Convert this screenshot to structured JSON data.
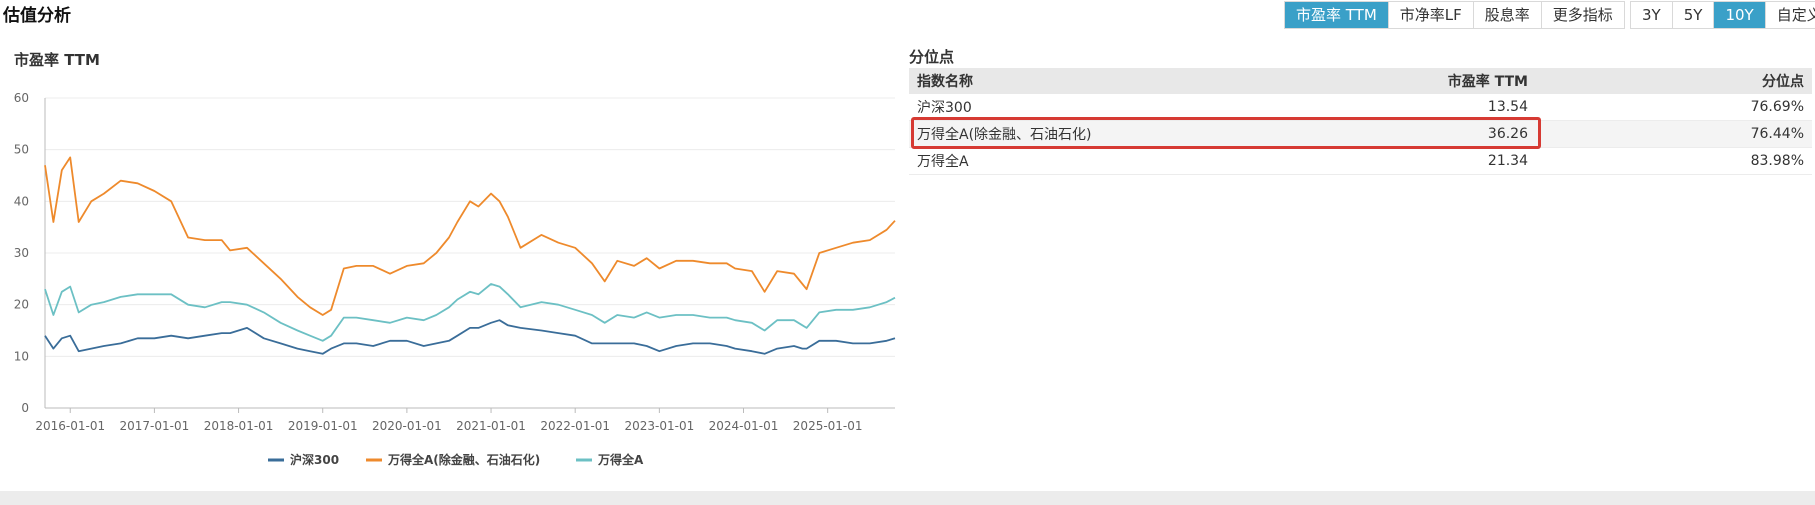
{
  "header": {
    "title": "估值分析",
    "metric_tabs": [
      {
        "label": "市盈率 TTM",
        "active": true
      },
      {
        "label": "市净率LF",
        "active": false
      },
      {
        "label": "股息率",
        "active": false
      },
      {
        "label": "更多指标",
        "active": false
      }
    ],
    "range_tabs": [
      {
        "label": "3Y",
        "active": false
      },
      {
        "label": "5Y",
        "active": false
      },
      {
        "label": "10Y",
        "active": true
      },
      {
        "label": "自定义",
        "active": false
      }
    ]
  },
  "chart": {
    "title": "市盈率 TTM"
  },
  "table": {
    "title": "分位点",
    "headers": [
      "指数名称",
      "市盈率 TTM",
      "分位点"
    ],
    "rows": [
      {
        "name": "沪深300",
        "pe": "13.54",
        "pct": "76.69%"
      },
      {
        "name": "万得全A(除金融、石油石化)",
        "pe": "36.26",
        "pct": "76.44%"
      },
      {
        "name": "万得全A",
        "pe": "21.34",
        "pct": "83.98%"
      }
    ]
  },
  "colors": {
    "accent": "#3aa0c8",
    "hs300": "#3a6d99",
    "wind_ex": "#ee8a2c",
    "wind_a": "#6cc0c4",
    "highlight": "#d63a33"
  },
  "chart_data": {
    "type": "line",
    "title": "市盈率 TTM",
    "ylim": [
      0,
      60
    ],
    "yticks": [
      0,
      10,
      20,
      30,
      40,
      50,
      60
    ],
    "xlim": [
      2015.7,
      2025.8
    ],
    "xticks": [
      "2016-01-01",
      "2017-01-01",
      "2018-01-01",
      "2019-01-01",
      "2020-01-01",
      "2021-01-01",
      "2022-01-01",
      "2023-01-01",
      "2024-01-01",
      "2025-01-01"
    ],
    "grid": "horizontal",
    "legend": "bottom",
    "x": [
      2015.7,
      2015.8,
      2015.9,
      2016.0,
      2016.1,
      2016.25,
      2016.4,
      2016.6,
      2016.8,
      2017.0,
      2017.2,
      2017.4,
      2017.6,
      2017.8,
      2017.9,
      2018.1,
      2018.3,
      2018.5,
      2018.7,
      2018.85,
      2019.0,
      2019.1,
      2019.25,
      2019.4,
      2019.6,
      2019.8,
      2020.0,
      2020.2,
      2020.35,
      2020.5,
      2020.6,
      2020.75,
      2020.85,
      2021.0,
      2021.1,
      2021.2,
      2021.35,
      2021.6,
      2021.8,
      2022.0,
      2022.2,
      2022.35,
      2022.5,
      2022.7,
      2022.85,
      2023.0,
      2023.2,
      2023.4,
      2023.6,
      2023.8,
      2023.9,
      2024.1,
      2024.25,
      2024.4,
      2024.6,
      2024.7,
      2024.75,
      2024.9,
      2025.1,
      2025.3,
      2025.5,
      2025.7,
      2025.8
    ],
    "series": [
      {
        "name": "沪深300",
        "values": [
          14.0,
          11.5,
          13.5,
          14.0,
          11.0,
          11.5,
          12.0,
          12.5,
          13.5,
          13.5,
          14.0,
          13.5,
          14.0,
          14.5,
          14.5,
          15.5,
          13.5,
          12.5,
          11.5,
          11.0,
          10.5,
          11.5,
          12.5,
          12.5,
          12.0,
          13.0,
          13.0,
          12.0,
          12.5,
          13.0,
          14.0,
          15.5,
          15.5,
          16.5,
          17.0,
          16.0,
          15.5,
          15.0,
          14.5,
          14.0,
          12.5,
          12.5,
          12.5,
          12.5,
          12.0,
          11.0,
          12.0,
          12.5,
          12.5,
          12.0,
          11.5,
          11.0,
          10.5,
          11.5,
          12.0,
          11.5,
          11.5,
          13.0,
          13.0,
          12.5,
          12.5,
          13.0,
          13.5
        ]
      },
      {
        "name": "万得全A(除金融、石油石化)",
        "values": [
          47.0,
          36.0,
          46.0,
          48.5,
          36.0,
          40.0,
          41.5,
          44.0,
          43.5,
          42.0,
          40.0,
          33.0,
          32.5,
          32.5,
          30.5,
          31.0,
          28.0,
          25.0,
          21.5,
          19.5,
          18.0,
          19.0,
          27.0,
          27.5,
          27.5,
          26.0,
          27.5,
          28.0,
          30.0,
          33.0,
          36.0,
          40.0,
          39.0,
          41.5,
          40.0,
          37.0,
          31.0,
          33.5,
          32.0,
          31.0,
          28.0,
          24.5,
          28.5,
          27.5,
          29.0,
          27.0,
          28.5,
          28.5,
          28.0,
          28.0,
          27.0,
          26.5,
          22.5,
          26.5,
          26.0,
          24.0,
          23.0,
          30.0,
          31.0,
          32.0,
          32.5,
          34.5,
          36.26
        ]
      },
      {
        "name": "万得全A",
        "values": [
          23.0,
          18.0,
          22.5,
          23.5,
          18.5,
          20.0,
          20.5,
          21.5,
          22.0,
          22.0,
          22.0,
          20.0,
          19.5,
          20.5,
          20.5,
          20.0,
          18.5,
          16.5,
          15.0,
          14.0,
          13.0,
          14.0,
          17.5,
          17.5,
          17.0,
          16.5,
          17.5,
          17.0,
          18.0,
          19.5,
          21.0,
          22.5,
          22.0,
          24.0,
          23.5,
          22.0,
          19.5,
          20.5,
          20.0,
          19.0,
          18.0,
          16.5,
          18.0,
          17.5,
          18.5,
          17.5,
          18.0,
          18.0,
          17.5,
          17.5,
          17.0,
          16.5,
          15.0,
          17.0,
          17.0,
          16.0,
          15.5,
          18.5,
          19.0,
          19.0,
          19.5,
          20.5,
          21.34
        ]
      }
    ]
  }
}
